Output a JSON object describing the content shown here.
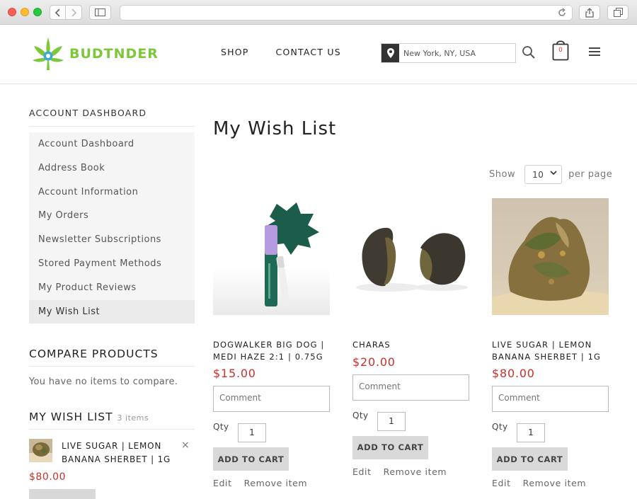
{
  "header": {
    "logo_text": "BUDTNDER",
    "nav": [
      "SHOP",
      "CONTACT US"
    ],
    "location_value": "New York, NY, USA",
    "cart_count": "0",
    "brand_color": "#7dc73a"
  },
  "sidebar": {
    "title": "ACCOUNT DASHBOARD",
    "items": [
      {
        "label": "Account Dashboard",
        "active": false
      },
      {
        "label": "Address Book",
        "active": false
      },
      {
        "label": "Account Information",
        "active": false
      },
      {
        "label": "My Orders",
        "active": false
      },
      {
        "label": "Newsletter Subscriptions",
        "active": false
      },
      {
        "label": "Stored Payment Methods",
        "active": false
      },
      {
        "label": "My Product Reviews",
        "active": false
      },
      {
        "label": "My Wish List",
        "active": true
      }
    ]
  },
  "compare": {
    "title": "COMPARE PRODUCTS",
    "empty_text": "You have no items to compare."
  },
  "wishlist_block": {
    "title": "MY WISH LIST",
    "count": "3 items",
    "item_name": "LIVE SUGAR | LEMON BANANA SHERBET | 1G",
    "item_price": "$80.00",
    "remove_icon": "×"
  },
  "main": {
    "title": "My Wish List",
    "show_label": "Show",
    "per_page_value": "10",
    "per_page_label": "per page",
    "products": [
      {
        "name": "DOGWALKER BIG DOG | MEDI HAZE 2:1 | 0.75G",
        "price": "$15.00",
        "comment_placeholder": "Comment",
        "qty_label": "Qty",
        "qty": "1",
        "add_to_cart": "ADD TO CART",
        "edit": "Edit",
        "remove": "Remove item"
      },
      {
        "name": "CHARAS",
        "price": "$20.00",
        "comment_placeholder": "Comment",
        "qty_label": "Qty",
        "qty": "1",
        "add_to_cart": "ADD TO CART",
        "edit": "Edit",
        "remove": "Remove item"
      },
      {
        "name": "LIVE SUGAR | LEMON BANANA SHERBET | 1G",
        "price": "$80.00",
        "comment_placeholder": "Comment",
        "qty_label": "Qty",
        "qty": "1",
        "add_to_cart": "ADD TO CART",
        "edit": "Edit",
        "remove": "Remove item"
      }
    ]
  },
  "colors": {
    "price": "#c8312c",
    "button_bg": "#d9d9d9"
  }
}
